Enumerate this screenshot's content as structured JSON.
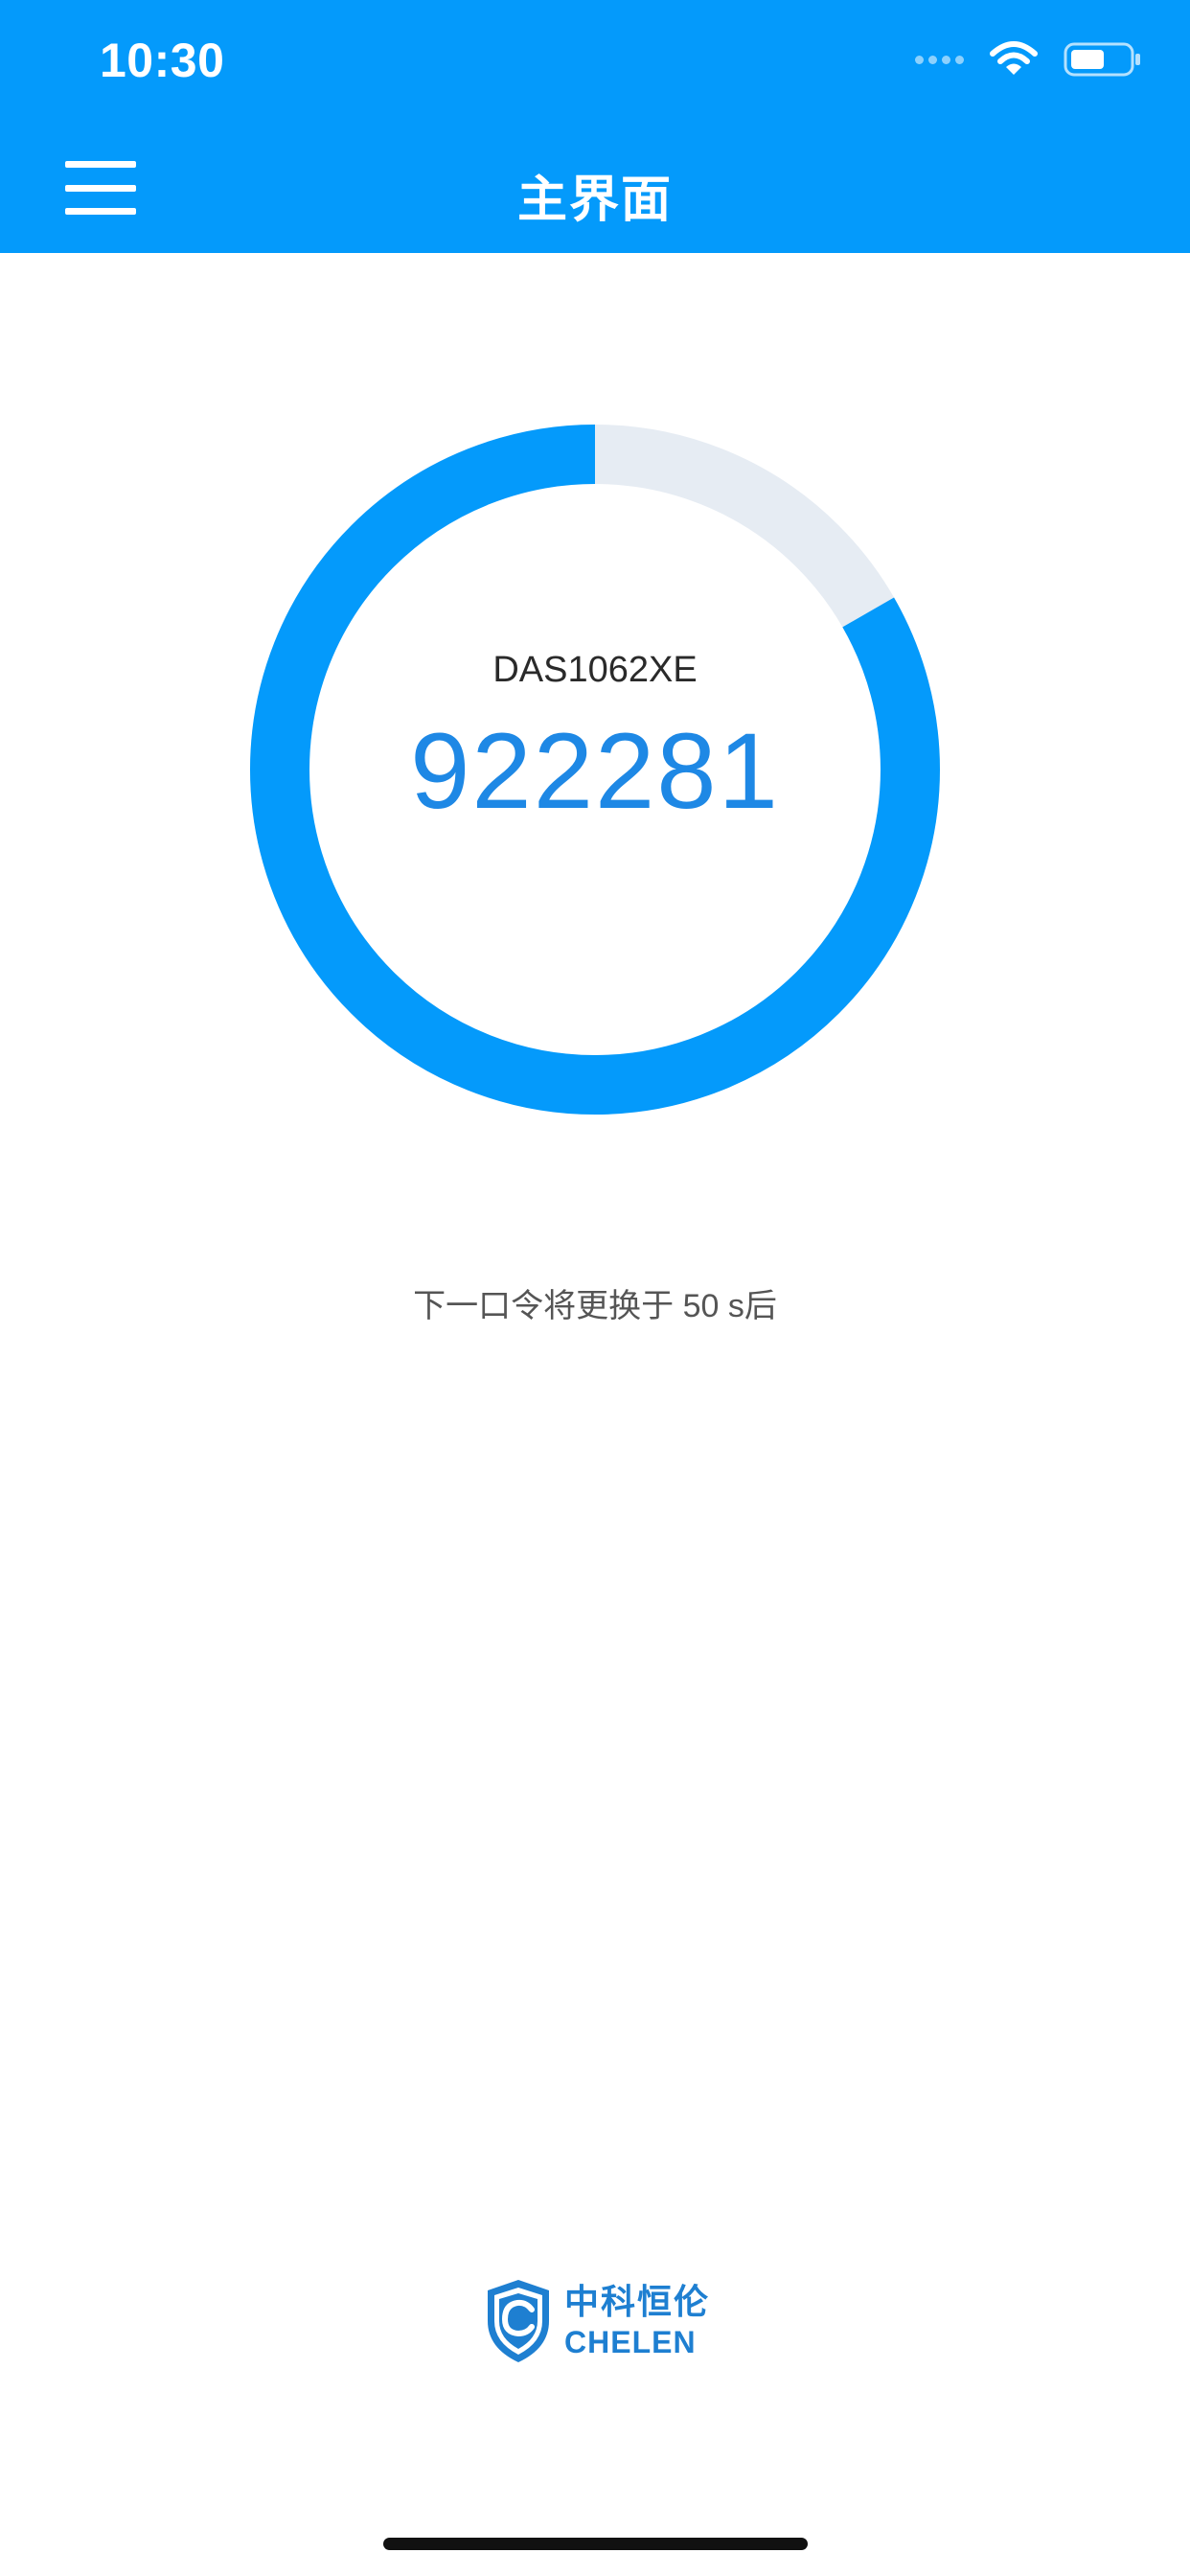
{
  "status_bar": {
    "time": "10:30",
    "icons": [
      "cellular-signal-icon",
      "wifi-icon",
      "battery-icon"
    ]
  },
  "header": {
    "title": "主界面",
    "menu_icon": "hamburger-menu-icon",
    "background_color": "#049AFB"
  },
  "token": {
    "name": "DAS1062XE",
    "code": "922281",
    "progress_fraction": 0.833,
    "ring_color": "#049AFB",
    "ring_track_color": "#E6ECF3",
    "code_color": "#1E88E5"
  },
  "countdown": {
    "text": "下一口令将更换于 50 s后"
  },
  "footer_logo": {
    "cn": "中科恒伦",
    "en": "CHELEN",
    "icon": "shield-c-logo-icon",
    "color": "#1E7FD1"
  }
}
